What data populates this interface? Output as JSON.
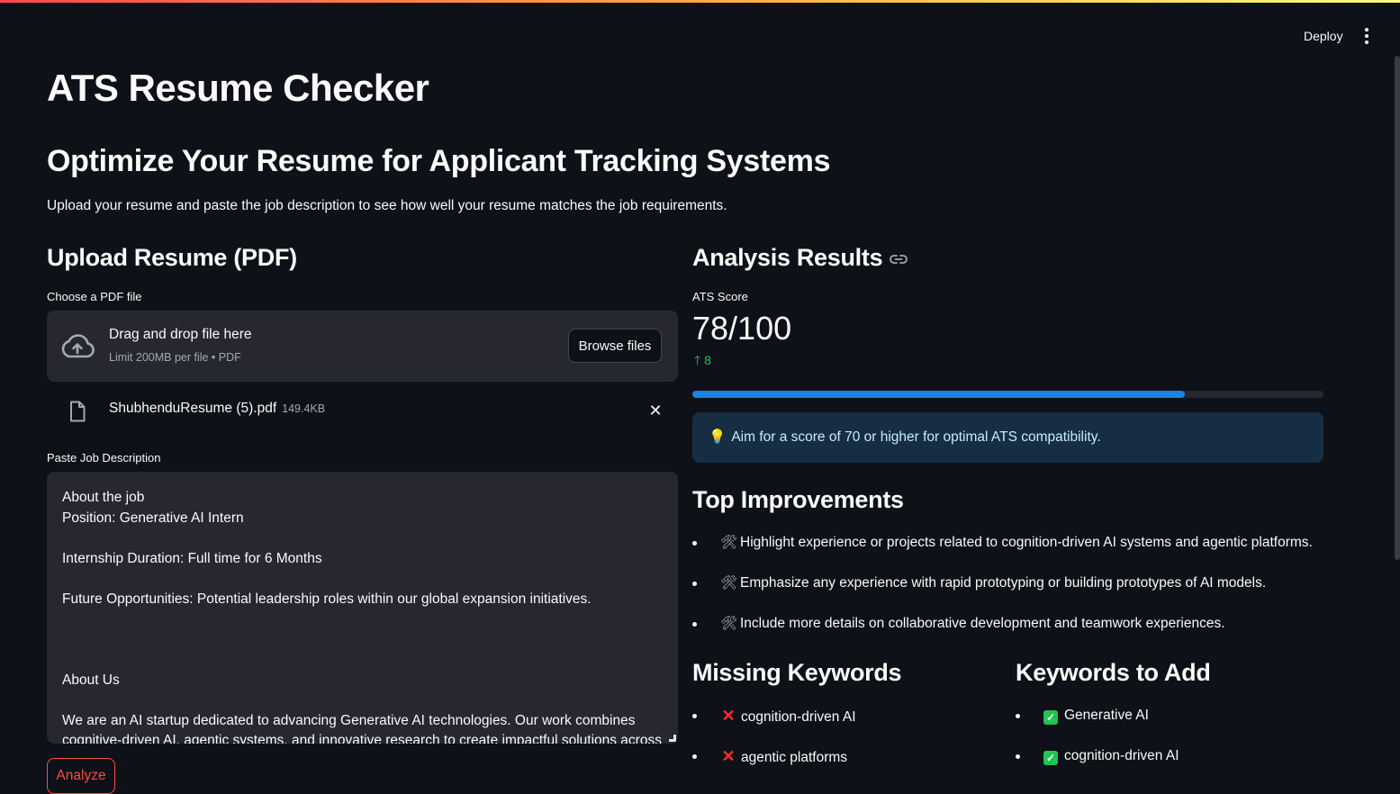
{
  "header": {
    "deploy_label": "Deploy",
    "menu_icon": "kebab-menu-icon"
  },
  "page": {
    "title": "ATS Resume Checker",
    "subtitle": "Optimize Your Resume for Applicant Tracking Systems",
    "intro": "Upload your resume and paste the job description to see how well your resume matches the job requirements."
  },
  "upload": {
    "heading": "Upload Resume (PDF)",
    "label": "Choose a PDF file",
    "dropzone_title": "Drag and drop file here",
    "dropzone_limit": "Limit 200MB per file • PDF",
    "browse_label": "Browse files",
    "file": {
      "name": "ShubhenduResume (5).pdf",
      "size": "149.4KB"
    }
  },
  "job_description": {
    "label": "Paste Job Description",
    "lines": [
      "About the job",
      "Position: Generative AI Intern",
      "",
      "Internship Duration: Full time for 6 Months",
      "",
      "Future Opportunities: Potential leadership roles within our global expansion initiatives.",
      "",
      "",
      "",
      "About Us",
      "",
      "We are an AI startup dedicated to advancing Generative AI technologies. Our work combines",
      "cognitive-driven AI, agentic systems, and innovative research to create impactful solutions across"
    ]
  },
  "analyze_label": "Analyze",
  "results": {
    "heading": "Analysis Results",
    "metric_label": "ATS Score",
    "metric_value": "78/100",
    "metric_delta": "8",
    "score_fraction": 0.78,
    "info_text": "Aim for a score of 70 or higher for optimal ATS compatibility.",
    "improvements_heading": "Top Improvements",
    "improvements": [
      "Highlight experience or projects related to cognition-driven AI systems and agentic platforms.",
      "Emphasize any experience with rapid prototyping or building prototypes of AI models.",
      "Include more details on collaborative development and teamwork experiences."
    ],
    "missing_heading": "Missing Keywords",
    "missing_keywords": [
      "cognition-driven AI",
      "agentic platforms"
    ],
    "add_heading": "Keywords to Add",
    "add_keywords": [
      "Generative AI",
      "cognition-driven AI"
    ]
  },
  "colors": {
    "background": "#0e1117",
    "surface": "#262730",
    "primary": "#ff4b4b",
    "progress": "#1c83e1",
    "info_bg": "#172d43",
    "success": "#21c354"
  }
}
